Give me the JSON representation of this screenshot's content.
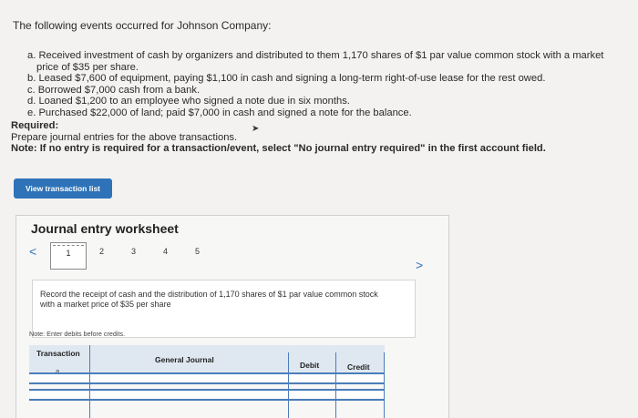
{
  "intro": "The following events occurred for Johnson Company:",
  "events": [
    "a. Received investment of cash by organizers and distributed to them 1,170 shares of $1 par value common stock with a market",
    "price of $35 per share.",
    "b. Leased $7,600 of equipment, paying $1,100 in cash and signing a long-term right-of-use lease for the rest owed.",
    "c. Borrowed $7,000 cash from a bank.",
    "d. Loaned $1,200 to an employee who signed a note due in six months.",
    "e. Purchased $22,000 of land; paid $7,000 in cash and signed a note for the balance."
  ],
  "required": {
    "heading": "Required:",
    "text": "Prepare journal entries for the above transactions.",
    "note": "Note: If no entry is required for a transaction/event, select \"No journal entry required\" in the first account field."
  },
  "buttons": {
    "view_transaction_list": "View transaction list"
  },
  "worksheet": {
    "title": "Journal entry worksheet",
    "pages": [
      "1",
      "2",
      "3",
      "4",
      "5"
    ],
    "current_page": 1,
    "description": "Record the receipt of cash and the distribution of 1,170 shares of $1 par value common stock with a market price of $35 per share",
    "note": "Note: Enter debits before credits.",
    "columns": [
      "Transaction",
      "General Journal",
      "Debit",
      "Credit"
    ],
    "rows": [
      {
        "transaction": "a."
      }
    ]
  },
  "colors": {
    "accent": "#2e73b8",
    "header_bg": "#dfe8f1",
    "grid": "#4b7dba"
  }
}
